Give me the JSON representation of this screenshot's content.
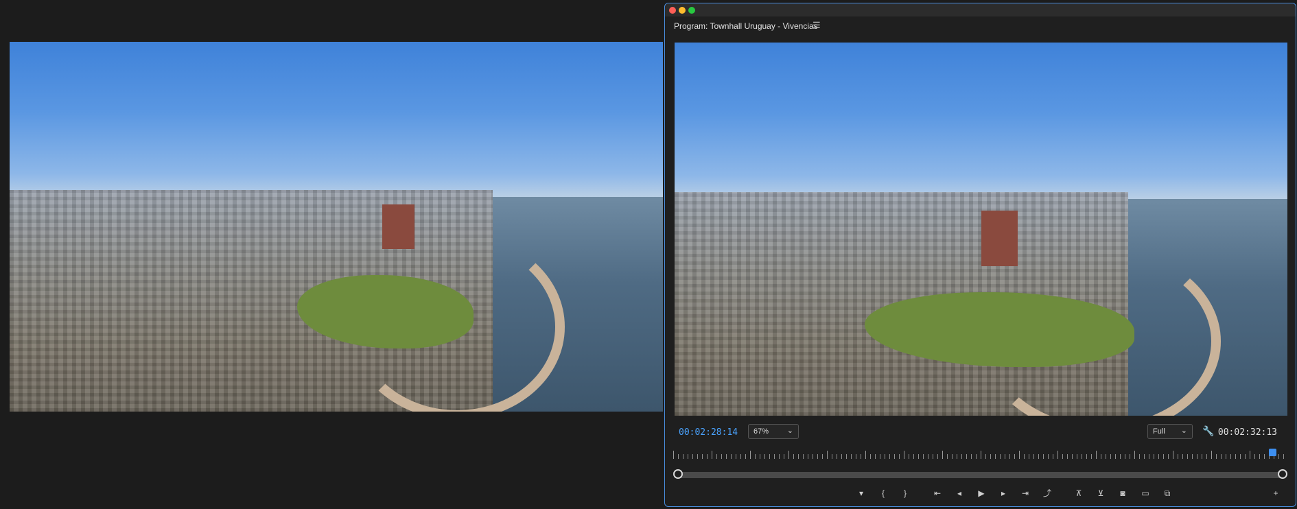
{
  "program_panel": {
    "title": "Program: Townhall Uruguay - Vivencias",
    "menu_icon": "hamburger-menu-icon",
    "current_timecode": "00:02:28:14",
    "duration_timecode": "00:02:32:13",
    "zoom_level": "67%",
    "playback_resolution": "Full",
    "playhead_position_fraction": 0.975
  },
  "controls": {
    "icons": [
      "add-marker-icon",
      "mark-in-icon",
      "mark-out-icon",
      "go-to-in-icon",
      "step-back-icon",
      "play-icon",
      "step-forward-icon",
      "go-to-out-icon",
      "export-frame-icon",
      "lift-icon",
      "extract-icon",
      "camera-icon",
      "safe-margins-icon",
      "compare-view-icon",
      "add-button-icon"
    ]
  },
  "colors": {
    "accent": "#4aa3ff",
    "window_border": "#4a8fe0",
    "background": "#1c1c1c"
  }
}
